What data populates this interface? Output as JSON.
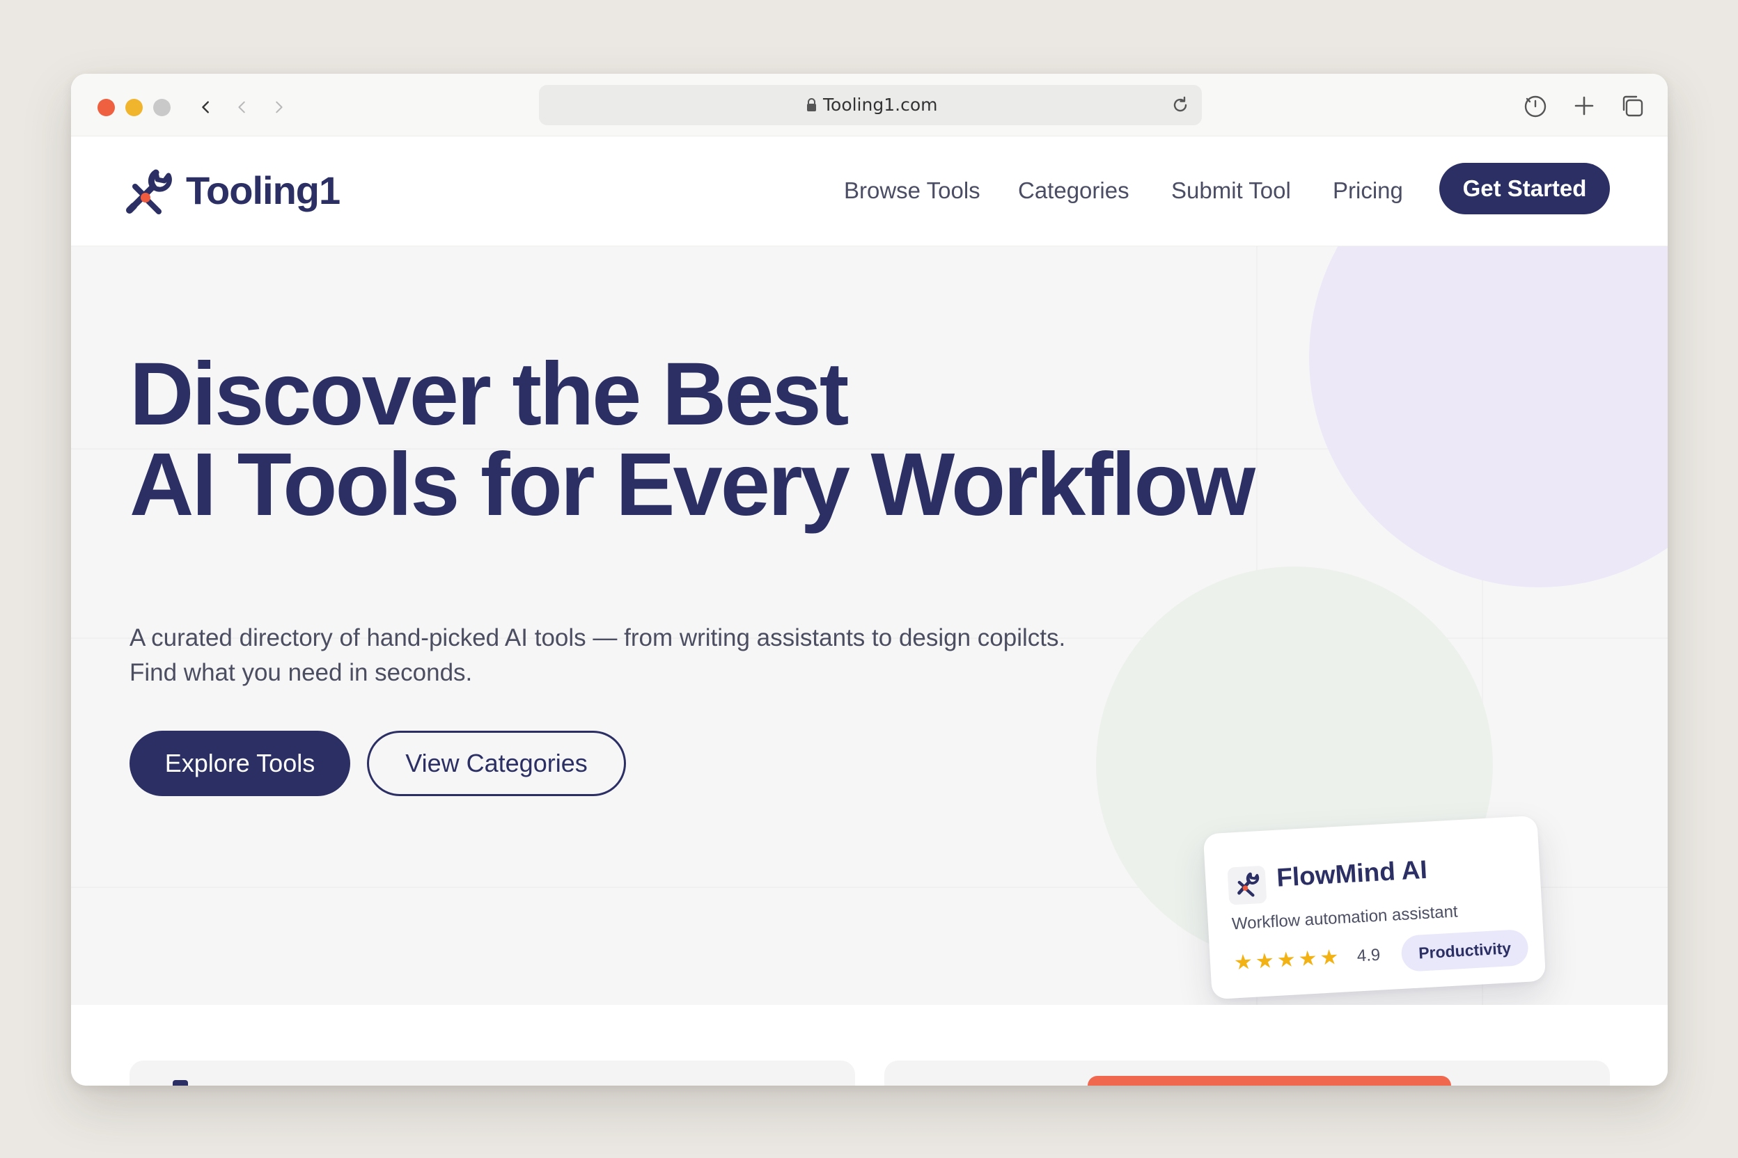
{
  "browser": {
    "url": "Tooling1.com",
    "icons": [
      "back-icon",
      "back-disabled-icon",
      "forward-icon",
      "lock-icon",
      "reload-icon",
      "history-icon",
      "plus-icon",
      "tabs-icon"
    ]
  },
  "site": {
    "brand": "Tooling1",
    "nav": [
      "Browse Tools",
      "Categories",
      "Submit Tool",
      "Pricing"
    ],
    "cta": "Get Started"
  },
  "hero": {
    "title_line1": "Discover the Best",
    "title_line2": "AI Tools for Every Workflow",
    "subtitle_line1": "A curated directory of hand-picked AI tools — from writing assistants to design copilcts.",
    "subtitle_line2": "Find what you need in seconds.",
    "primary_button": "Explore Tools",
    "secondary_button": "View Categories"
  },
  "card": {
    "name": "FlowMind AI",
    "description": "Workflow automation assistant",
    "stars": [
      "★",
      "★",
      "★",
      "★",
      "★"
    ],
    "rating": "4.9",
    "badge": "Productivity"
  },
  "colors": {
    "primary": "#2b2f63",
    "accent_orange": "#f0694f",
    "star": "#f2b214",
    "badge_bg": "#e9e8fb",
    "traffic_red": "#ee6040",
    "traffic_yellow": "#f1b42d"
  }
}
